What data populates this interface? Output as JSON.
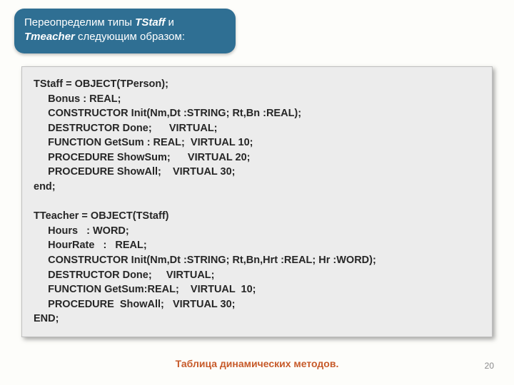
{
  "callout": {
    "prefix": "Переопределим типы ",
    "type1": "TStaff",
    "middle": " и ",
    "type2": "Tтeacher",
    "suffix": " следующим образом:"
  },
  "code": {
    "lines": [
      "TStaff = OBJECT(TPerson);",
      "     Bonus : REAL;",
      "     CONSTRUCTOR Init(Nm,Dt :STRING; Rt,Bn :REAL);",
      "     DESTRUCTOR Done;      VIRTUAL;",
      "     FUNCTION GetSum : REAL;  VIRTUAL 10;",
      "     PROCEDURE ShowSum;      VIRTUAL 20;",
      "     PROCEDURE ShowAll;    VIRTUAL 30;",
      "end;",
      "",
      "TTeacher = OBJECT(TStaff)",
      "     Hours   : WORD;",
      "     HourRate   :   REAL;",
      "     CONSTRUCTOR Init(Nm,Dt :STRING; Rt,Bn,Hrt :REAL; Hr :WORD);",
      "     DESTRUCTOR Done;     VIRTUAL;",
      "     FUNCTION GetSum:REAL;    VIRTUAL  10;",
      "     PROCEDURE  ShowAll;   VIRTUAL 30;",
      "END;"
    ]
  },
  "caption": "Таблица динамических методов.",
  "page_number": "20"
}
